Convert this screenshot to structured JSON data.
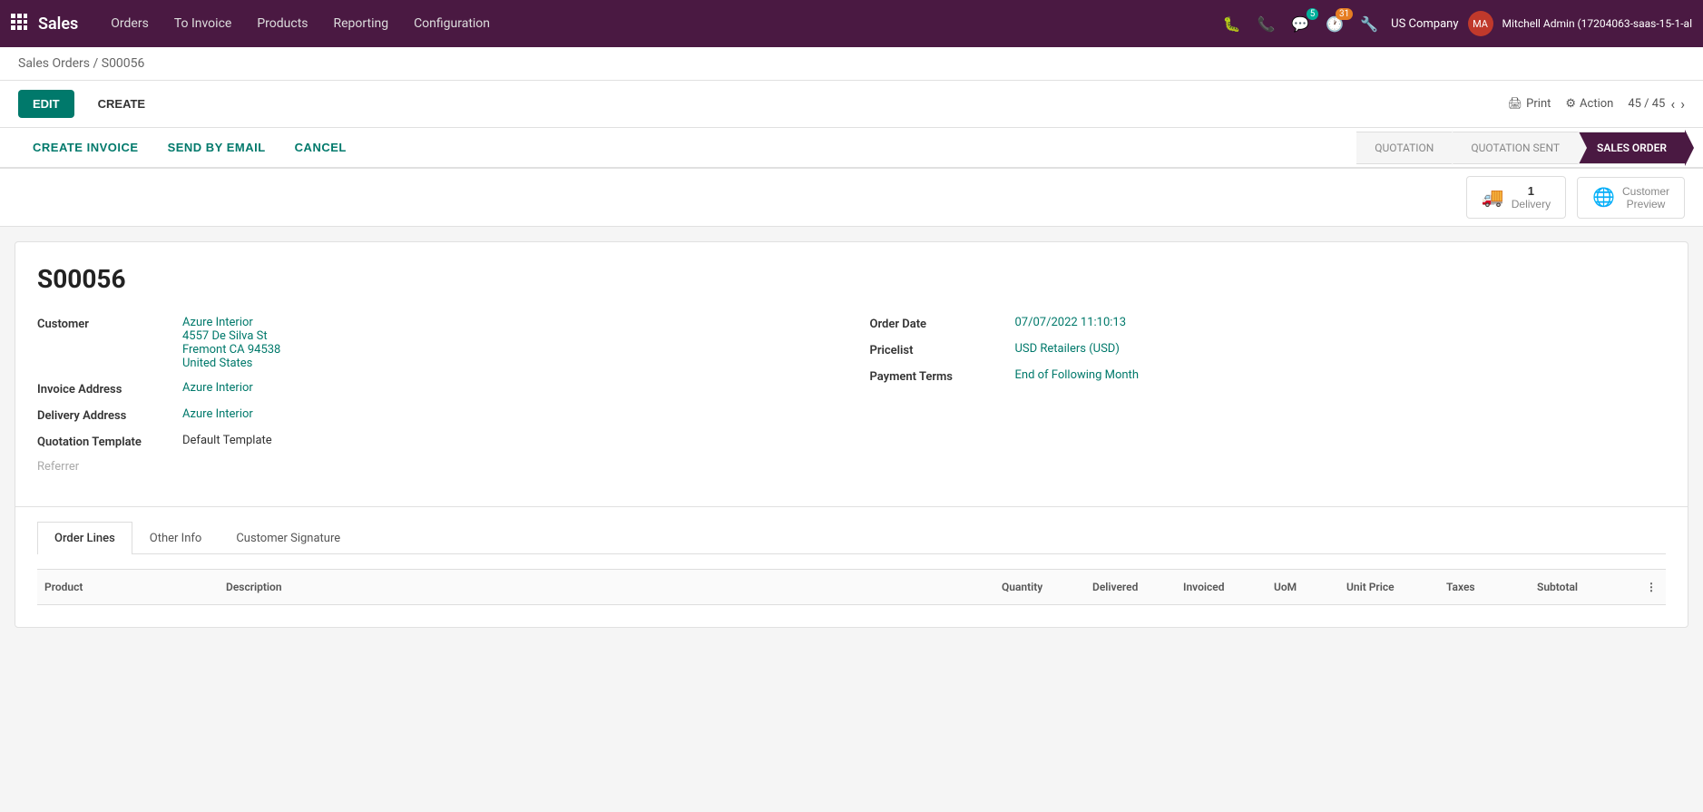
{
  "nav": {
    "app_icon": "⊞",
    "app_name": "Sales",
    "links": [
      "Orders",
      "To Invoice",
      "Products",
      "Reporting",
      "Configuration"
    ],
    "icons": {
      "bug": "🐛",
      "phone": "📞",
      "chat": "💬",
      "chat_badge": "5",
      "clock": "🕐",
      "clock_badge": "31",
      "tools": "🔧"
    },
    "company": "US Company",
    "user": "Mitchell Admin (17204063-saas-15-1-al"
  },
  "breadcrumb": {
    "parent": "Sales Orders",
    "separator": "/",
    "current": "S00056"
  },
  "toolbar": {
    "edit_label": "EDIT",
    "create_label": "CREATE",
    "print_label": "Print",
    "action_label": "Action",
    "pagination": "45 / 45"
  },
  "action_bar": {
    "create_invoice": "CREATE INVOICE",
    "send_by_email": "SEND BY EMAIL",
    "cancel": "CANCEL",
    "status_steps": [
      {
        "label": "QUOTATION",
        "active": false
      },
      {
        "label": "QUOTATION SENT",
        "active": false
      },
      {
        "label": "SALES ORDER",
        "active": true
      }
    ]
  },
  "smart_buttons": {
    "delivery": {
      "icon": "🚚",
      "count": "1",
      "label": "Delivery"
    },
    "customer_preview": {
      "icon": "🌐",
      "label": "Customer\nPreview"
    }
  },
  "order": {
    "number": "S00056",
    "customer_label": "Customer",
    "customer_name": "Azure Interior",
    "customer_address1": "4557 De Silva St",
    "customer_address2": "Fremont CA 94538",
    "customer_address3": "United States",
    "invoice_address_label": "Invoice Address",
    "invoice_address": "Azure Interior",
    "delivery_address_label": "Delivery Address",
    "delivery_address": "Azure Interior",
    "quotation_template_label": "Quotation Template",
    "quotation_template": "Default Template",
    "referrer_placeholder": "Referrer",
    "order_date_label": "Order Date",
    "order_date": "07/07/2022 11:10:13",
    "pricelist_label": "Pricelist",
    "pricelist": "USD Retailers (USD)",
    "payment_terms_label": "Payment Terms",
    "payment_terms": "End of Following Month"
  },
  "tabs": [
    {
      "label": "Order Lines",
      "active": true
    },
    {
      "label": "Other Info",
      "active": false
    },
    {
      "label": "Customer Signature",
      "active": false
    }
  ],
  "table": {
    "columns": [
      "Product",
      "Description",
      "Quantity",
      "Delivered",
      "Invoiced",
      "UoM",
      "Unit Price",
      "Taxes",
      "Subtotal",
      ""
    ]
  }
}
